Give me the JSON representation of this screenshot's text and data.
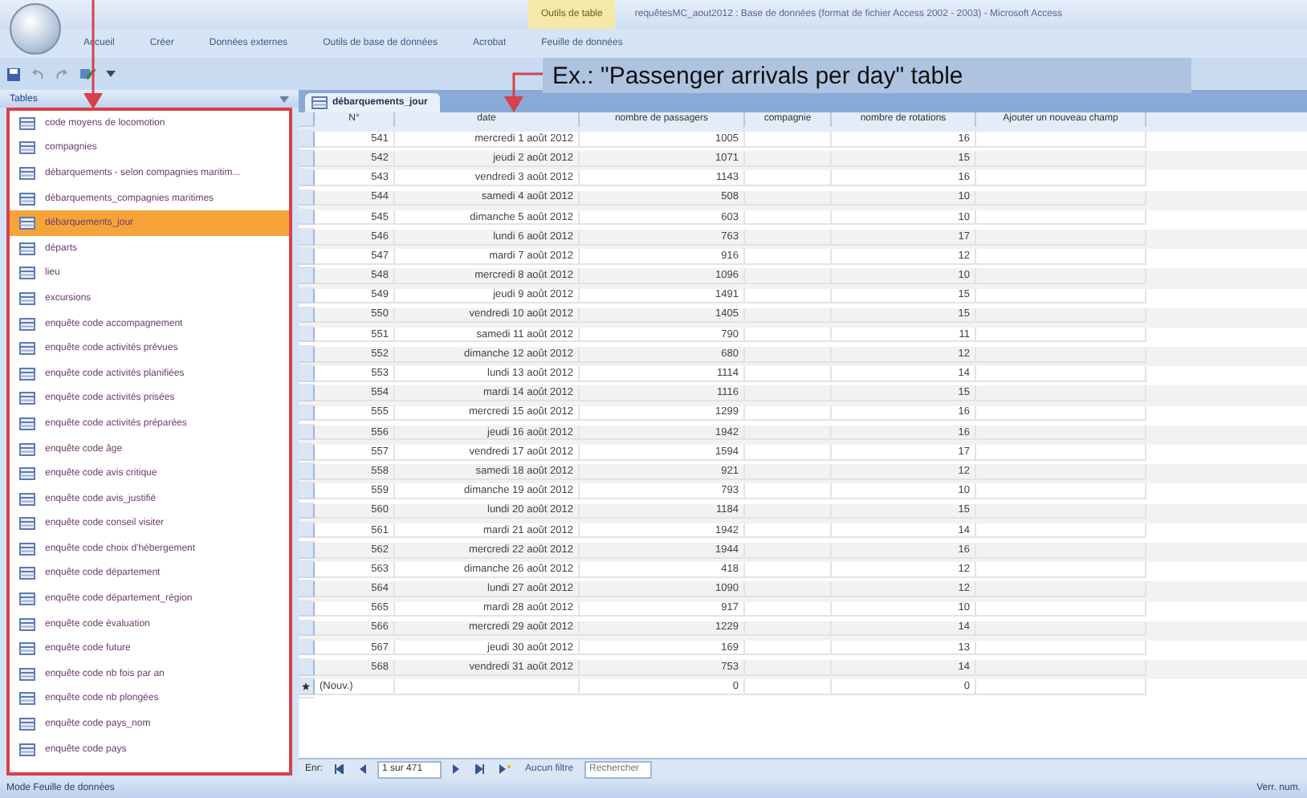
{
  "window": {
    "title": "requêtesMC_aout2012 : Base de données (format de fichier Access 2002 - 2003) - Microsoft Access",
    "context_tab": "Outils de table"
  },
  "ribbon_tabs": [
    {
      "label": "Accueil",
      "selected": false
    },
    {
      "label": "Créer",
      "selected": false
    },
    {
      "label": "Données externes",
      "selected": false
    },
    {
      "label": "Outils de base de données",
      "selected": false
    },
    {
      "label": "Acrobat",
      "selected": false
    },
    {
      "label": "Feuille de données",
      "selected": false
    }
  ],
  "nav_pane": {
    "title": "Tables",
    "items": [
      {
        "label": "code moyens de locomotion",
        "selected": false
      },
      {
        "label": "compagnies",
        "selected": false
      },
      {
        "label": "débarquements - selon compagnies maritim...",
        "selected": false
      },
      {
        "label": "débarquements_compagnies maritimes",
        "selected": false
      },
      {
        "label": "débarquements_jour",
        "selected": true
      },
      {
        "label": "départs",
        "selected": false
      },
      {
        "label": "lieu",
        "selected": false
      },
      {
        "label": "excursions",
        "selected": false
      },
      {
        "label": "enquête code accompagnement",
        "selected": false
      },
      {
        "label": "enquête code activités prévues",
        "selected": false
      },
      {
        "label": "enquête code activités planifiées",
        "selected": false
      },
      {
        "label": "enquête code activités prisées",
        "selected": false
      },
      {
        "label": "enquête code activités préparées",
        "selected": false
      },
      {
        "label": "enquête code âge",
        "selected": false
      },
      {
        "label": "enquête code avis critique",
        "selected": false
      },
      {
        "label": "enquête code avis_justifié",
        "selected": false
      },
      {
        "label": "enquête code conseil visiter",
        "selected": false
      },
      {
        "label": "enquête code choix d'hébergement",
        "selected": false
      },
      {
        "label": "enquête code département",
        "selected": false
      },
      {
        "label": "enquête code département_région",
        "selected": false
      },
      {
        "label": "enquête code évaluation",
        "selected": false
      },
      {
        "label": "enquête code future",
        "selected": false
      },
      {
        "label": "enquête code nb fois par an",
        "selected": false
      },
      {
        "label": "enquête code nb plongées",
        "selected": false
      },
      {
        "label": "enquête code pays_nom",
        "selected": false
      },
      {
        "label": "enquête code pays",
        "selected": false
      }
    ]
  },
  "document_tab": {
    "label": "débarquements_jour",
    "selected": true
  },
  "annotation": {
    "text": "Ex.: \"Passenger arrivals per day\" table"
  },
  "table": {
    "columns": [
      "N°",
      "date",
      "nombre de passagers",
      "compagnie",
      "nombre de rotations",
      "Ajouter un nouveau champ"
    ],
    "rows": [
      [
        "541",
        "mercredi 1 août 2012",
        "1005",
        "",
        "16"
      ],
      [
        "542",
        "jeudi 2 août 2012",
        "1071",
        "",
        "15"
      ],
      [
        "543",
        "vendredi 3 août 2012",
        "1143",
        "",
        "16"
      ],
      [
        "544",
        "samedi 4 août 2012",
        "508",
        "",
        "10"
      ],
      [
        "545",
        "dimanche 5 août 2012",
        "603",
        "",
        "10"
      ],
      [
        "546",
        "lundi 6 août 2012",
        "763",
        "",
        "17"
      ],
      [
        "547",
        "mardi 7 août 2012",
        "916",
        "",
        "12"
      ],
      [
        "548",
        "mercredi 8 août 2012",
        "1096",
        "",
        "10"
      ],
      [
        "549",
        "jeudi 9 août 2012",
        "1491",
        "",
        "15"
      ],
      [
        "550",
        "vendredi 10 août 2012",
        "1405",
        "",
        "15"
      ],
      [
        "551",
        "samedi 11 août 2012",
        "790",
        "",
        "11"
      ],
      [
        "552",
        "dimanche 12 août 2012",
        "680",
        "",
        "12"
      ],
      [
        "553",
        "lundi 13 août 2012",
        "1114",
        "",
        "14"
      ],
      [
        "554",
        "mardi 14 août 2012",
        "1116",
        "",
        "15"
      ],
      [
        "555",
        "mercredi 15 août 2012",
        "1299",
        "",
        "16"
      ],
      [
        "556",
        "jeudi 16 août 2012",
        "1942",
        "",
        "16"
      ],
      [
        "557",
        "vendredi 17 août 2012",
        "1594",
        "",
        "17"
      ],
      [
        "558",
        "samedi 18 août 2012",
        "921",
        "",
        "12"
      ],
      [
        "559",
        "dimanche 19 août 2012",
        "793",
        "",
        "10"
      ],
      [
        "560",
        "lundi 20 août 2012",
        "1184",
        "",
        "15"
      ],
      [
        "561",
        "mardi 21 août 2012",
        "1942",
        "",
        "14"
      ],
      [
        "562",
        "mercredi 22 août 2012",
        "1944",
        "",
        "16"
      ],
      [
        "563",
        "dimanche 26 août 2012",
        "418",
        "",
        "12"
      ],
      [
        "564",
        "lundi 27 août 2012",
        "1090",
        "",
        "12"
      ],
      [
        "565",
        "mardi 28 août 2012",
        "917",
        "",
        "10"
      ],
      [
        "566",
        "mercredi 29 août 2012",
        "1229",
        "",
        "14"
      ],
      [
        "567",
        "jeudi 30 août 2012",
        "169",
        "",
        "13"
      ],
      [
        "568",
        "vendredi 31 août 2012",
        "753",
        "",
        "14"
      ]
    ],
    "new_row": {
      "label": "(Nouv.)",
      "passengers": "0",
      "rotations": "0"
    }
  },
  "record_nav": {
    "label": "Enr:",
    "position": "1 sur 471",
    "filter": "Aucun filtre",
    "placeholder": "Rechercher"
  },
  "status_bar": {
    "mode": "Mode Feuille de données",
    "indicator": "Verr. num."
  }
}
